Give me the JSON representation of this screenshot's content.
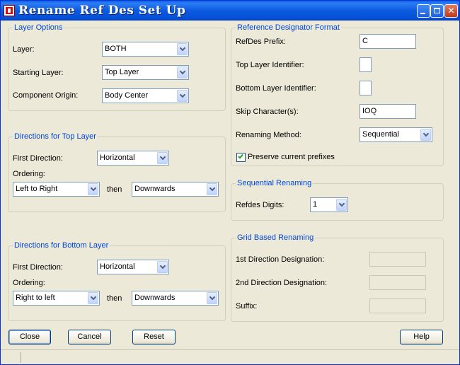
{
  "window": {
    "title": "Rename Ref Des Set Up"
  },
  "layer_options": {
    "legend": "Layer Options",
    "layer": {
      "label": "Layer:",
      "value": "BOTH"
    },
    "starting_layer": {
      "label": "Starting Layer:",
      "value": "Top Layer"
    },
    "component_origin": {
      "label": "Component Origin:",
      "value": "Body Center"
    }
  },
  "top_layer": {
    "legend": "Directions for Top Layer",
    "first_direction": {
      "label": "First Direction:",
      "value": "Horizontal"
    },
    "ordering_label": "Ordering:",
    "ordering_first": "Left to Right",
    "then_label": "then",
    "ordering_second": "Downwards"
  },
  "bottom_layer": {
    "legend": "Directions for Bottom Layer",
    "first_direction": {
      "label": "First Direction:",
      "value": "Horizontal"
    },
    "ordering_label": "Ordering:",
    "ordering_first": "Right to left",
    "then_label": "then",
    "ordering_second": "Downwards"
  },
  "refdes_format": {
    "legend": "Reference Designator Format",
    "prefix": {
      "label": "RefDes Prefix:",
      "value": "C"
    },
    "top_identifier": {
      "label": "Top Layer Identifier:",
      "value": ""
    },
    "bottom_identifier": {
      "label": "Bottom Layer Identifier:",
      "value": ""
    },
    "skip_characters": {
      "label": "Skip Character(s):",
      "value": "IOQ"
    },
    "renaming_method": {
      "label": "Renaming Method:",
      "value": "Sequential"
    },
    "preserve_prefixes": {
      "label": "Preserve current prefixes",
      "checked": true
    }
  },
  "sequential": {
    "legend": "Sequential Renaming",
    "digits": {
      "label": "Refdes Digits:",
      "value": "1"
    }
  },
  "grid": {
    "legend": "Grid Based Renaming",
    "first_designation": {
      "label": "1st Direction Designation:",
      "value": ""
    },
    "second_designation": {
      "label": "2nd Direction Designation:",
      "value": ""
    },
    "suffix": {
      "label": "Suffix:",
      "value": ""
    }
  },
  "buttons": {
    "close": "Close",
    "cancel": "Cancel",
    "reset": "Reset",
    "help": "Help"
  }
}
